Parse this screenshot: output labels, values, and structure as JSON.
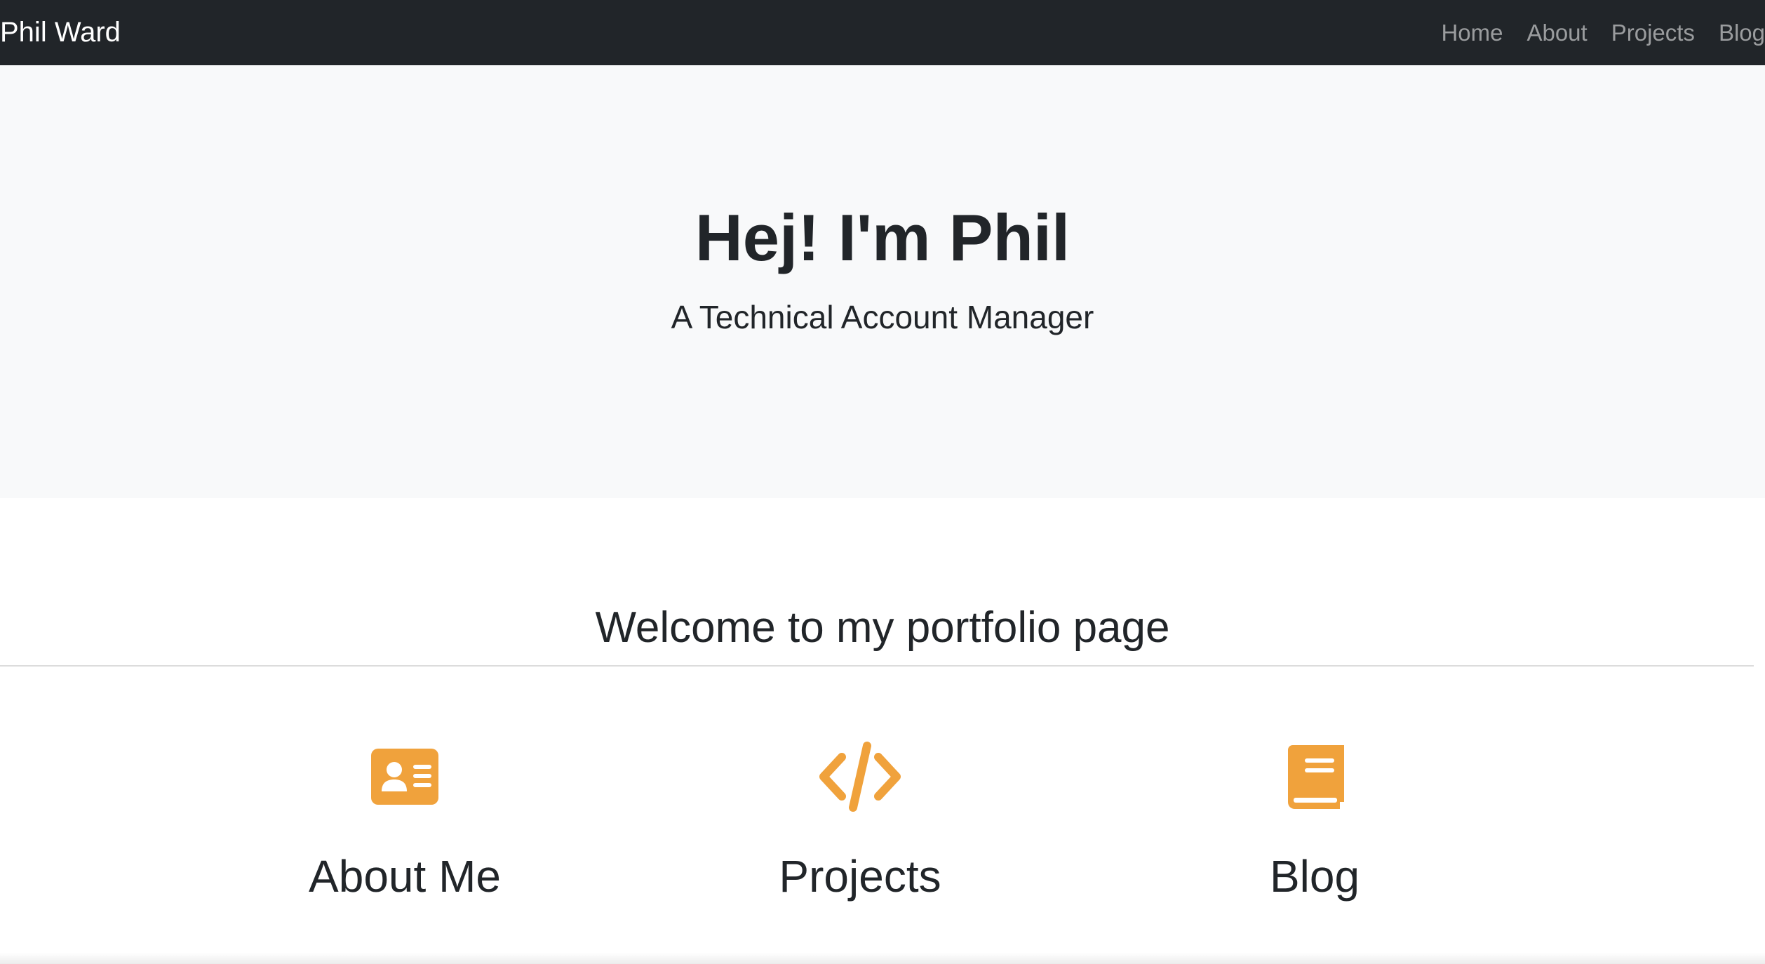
{
  "navbar": {
    "brand": "Phil Ward",
    "links": [
      "Home",
      "About",
      "Projects",
      "Blog"
    ]
  },
  "hero": {
    "title": "Hej! I'm Phil",
    "subtitle": "A Technical Account Manager"
  },
  "welcome": {
    "heading": "Welcome to my portfolio page"
  },
  "features": [
    {
      "title": "About Me",
      "icon": "id-card-icon"
    },
    {
      "title": "Projects",
      "icon": "code-icon"
    },
    {
      "title": "Blog",
      "icon": "book-icon"
    }
  ],
  "colors": {
    "navbar_bg": "#212529",
    "hero_bg": "#f8f9fa",
    "accent": "#f0a23c",
    "text": "#212529"
  }
}
